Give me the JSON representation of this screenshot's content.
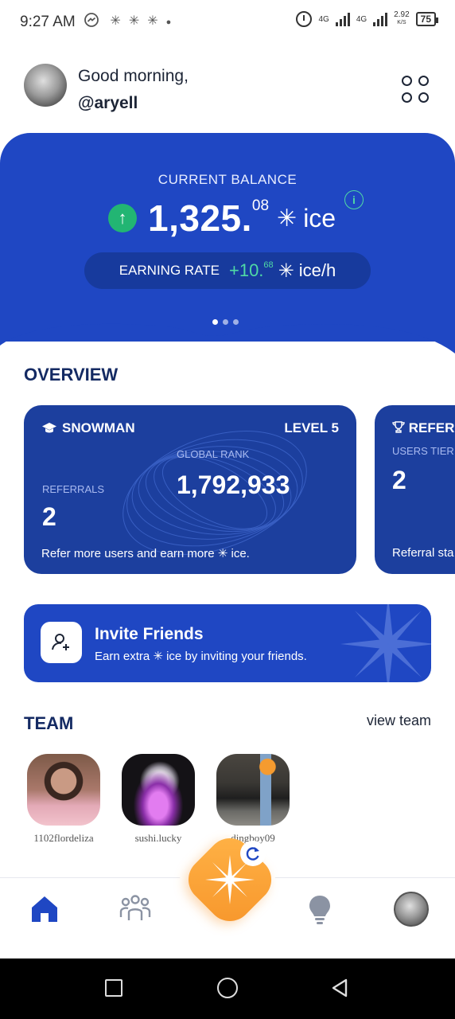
{
  "status_bar": {
    "time": "9:27 AM",
    "left_icons": [
      "messenger-icon",
      "snowflake-icon",
      "snowflake-icon",
      "snowflake-icon",
      "dot-icon"
    ],
    "net_1": "4G",
    "net_2": "4G",
    "speed_value": "2.92",
    "speed_unit": "K/S",
    "battery": "75"
  },
  "header": {
    "greeting": "Good morning,",
    "username": "@aryell"
  },
  "balance": {
    "label": "CURRENT BALANCE",
    "integer": "1,325.",
    "decimal": "08",
    "unit": "ice",
    "info": "i",
    "up_arrow": "↑",
    "rate_label": "EARNING RATE",
    "rate_integer": "+10.",
    "rate_decimal": "68",
    "rate_unit": "ice/h",
    "ice_glyph": "✳",
    "pages": 3,
    "active_page": 1
  },
  "overview": {
    "title": "OVERVIEW",
    "snowman_card": {
      "title": "SNOWMAN",
      "level": "LEVEL 5",
      "referrals_label": "REFERRALS",
      "referrals_value": "2",
      "rank_label": "GLOBAL RANK",
      "rank_value": "1,792,933",
      "footer": "Refer more users and earn more ✳ ice."
    },
    "referrals_card": {
      "title": "REFER",
      "label": "USERS TIER",
      "value": "2",
      "footer": "Referral sta"
    }
  },
  "invite": {
    "title": "Invite Friends",
    "subtitle": "Earn extra ✳ ice by inviting your friends."
  },
  "team": {
    "title": "TEAM",
    "view_link": "view team",
    "members": [
      {
        "name": "1102flordeliza"
      },
      {
        "name": "sushi.lucky"
      },
      {
        "name": "dingboy09"
      }
    ]
  },
  "colors": {
    "primary_blue": "#1f47c3",
    "card_blue": "#1c3f9e",
    "accent_green": "#4fd9a5",
    "tap_orange": "#f7962b"
  }
}
